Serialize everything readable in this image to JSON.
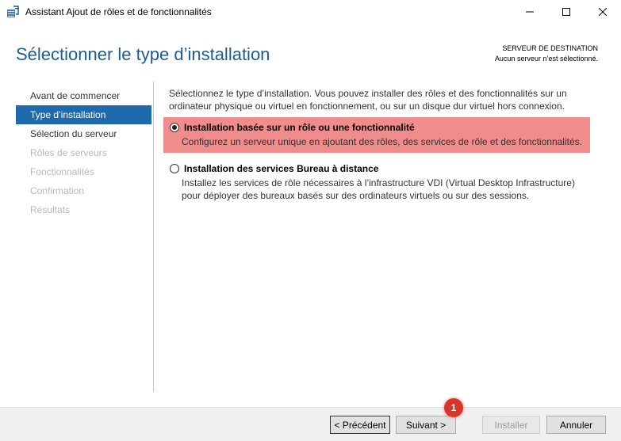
{
  "window": {
    "title": "Assistant Ajout de rôles et de fonctionnalités",
    "icon": "server-manager-icon"
  },
  "header": {
    "title": "Sélectionner le type d’installation",
    "destination_label": "SERVEUR DE DESTINATION",
    "destination_value": "Aucun serveur n’est sélectionné."
  },
  "nav": {
    "items": [
      {
        "label": "Avant de commencer",
        "state": "normal"
      },
      {
        "label": "Type d’installation",
        "state": "active"
      },
      {
        "label": "Sélection du serveur",
        "state": "normal"
      },
      {
        "label": "Rôles de serveurs",
        "state": "disabled"
      },
      {
        "label": "Fonctionnalités",
        "state": "disabled"
      },
      {
        "label": "Confirmation",
        "state": "disabled"
      },
      {
        "label": "Résultats",
        "state": "disabled"
      }
    ]
  },
  "main": {
    "intro": "Sélectionnez le type d’installation. Vous pouvez installer des rôles et des fonctionnalités sur un ordinateur physique ou virtuel en fonctionnement, ou sur un disque dur virtuel hors connexion.",
    "options": [
      {
        "title": "Installation basée sur un rôle ou une fonctionnalité",
        "description": "Configurez un serveur unique en ajoutant des rôles, des services de rôle et des fonctionnalités.",
        "selected": true
      },
      {
        "title": "Installation des services Bureau à distance",
        "description": "Installez les services de rôle nécessaires à l’infrastructure VDI (Virtual Desktop Infrastructure) pour déployer des bureaux basés sur des ordinateurs virtuels ou sur des sessions.",
        "selected": false
      }
    ]
  },
  "footer": {
    "prev_label": "< Précédent",
    "next_label": "Suivant >",
    "install_label": "Installer",
    "cancel_label": "Annuler"
  },
  "callout": {
    "label": "1"
  },
  "colors": {
    "accent": "#1e6aac",
    "title_blue": "#1a5e8f",
    "highlight": "#f08c8c",
    "callout": "#d9362a"
  }
}
